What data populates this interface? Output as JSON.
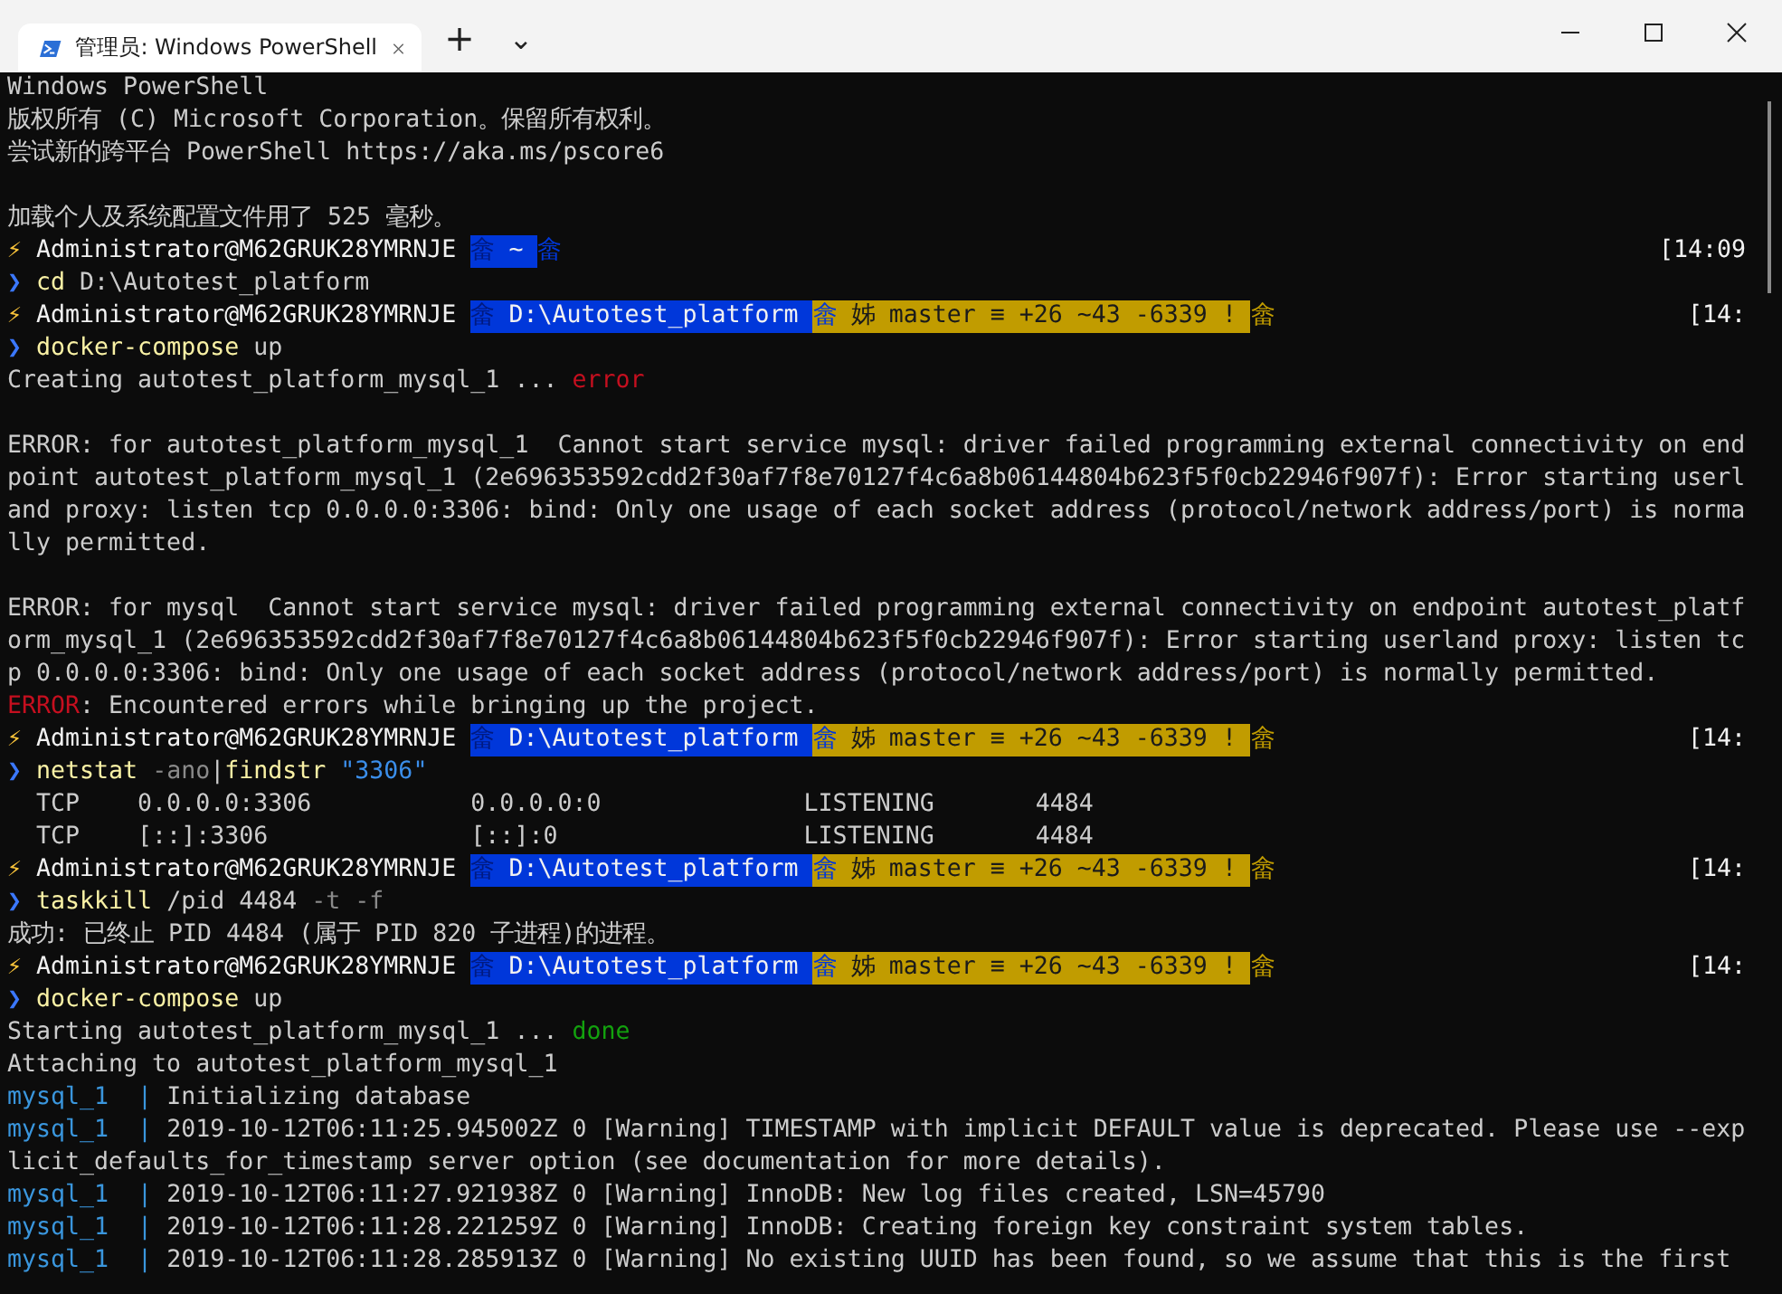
{
  "window": {
    "tab": {
      "title": "管理员: Windows PowerShell",
      "selected": true
    },
    "new_tab": "+",
    "dropdown": "⌄"
  },
  "terminal": {
    "lines": [
      {
        "kind": "output",
        "segments": [
          {
            "kind": "plain",
            "text": "Windows PowerShell"
          }
        ]
      },
      {
        "kind": "output",
        "segments": [
          {
            "kind": "plain",
            "text": "版权所有 (C) Microsoft Corporation。保留所有权利。"
          }
        ]
      },
      {
        "kind": "output",
        "segments": [
          {
            "kind": "plain",
            "text": "尝试新的跨平台 PowerShell https://aka.ms/pscore6"
          }
        ]
      },
      {
        "kind": "blank"
      },
      {
        "kind": "output",
        "segments": [
          {
            "kind": "plain",
            "text": "加载个人及系统配置文件用了 525 毫秒。"
          }
        ]
      },
      {
        "kind": "prompt",
        "time": "[14:09",
        "segments": [
          {
            "kind": "bolt",
            "text": "⚡"
          },
          {
            "kind": "user",
            "text": " Administrator@M62GRUK28YMRNJE "
          },
          {
            "kind": "pathsep",
            "text": "畲"
          },
          {
            "kind": "path",
            "text": " ~ "
          },
          {
            "kind": "endblue",
            "text": "畲"
          }
        ]
      },
      {
        "kind": "output",
        "segments": [
          {
            "kind": "caret",
            "text": "❯"
          },
          {
            "kind": "cmd",
            "text": " cd"
          },
          {
            "kind": "plain",
            "text": " D:\\Autotest_platform"
          }
        ]
      },
      {
        "kind": "prompt",
        "time": "[14:",
        "segments": [
          {
            "kind": "bolt",
            "text": "⚡"
          },
          {
            "kind": "user",
            "text": " Administrator@M62GRUK28YMRNJE "
          },
          {
            "kind": "pathsep",
            "text": "畲"
          },
          {
            "kind": "path",
            "text": " D:\\Autotest_platform "
          },
          {
            "kind": "gitsep",
            "text": "畲"
          },
          {
            "kind": "git",
            "text": " 姊 master ≡ +26 ~43 -6339 ! "
          },
          {
            "kind": "endgold",
            "text": "畲"
          }
        ]
      },
      {
        "kind": "output",
        "segments": [
          {
            "kind": "caret",
            "text": "❯"
          },
          {
            "kind": "cmd",
            "text": " docker-compose"
          },
          {
            "kind": "plain",
            "text": " up"
          }
        ]
      },
      {
        "kind": "output",
        "segments": [
          {
            "kind": "plain",
            "text": "Creating autotest_platform_mysql_1 ... "
          },
          {
            "kind": "err",
            "text": "error"
          }
        ]
      },
      {
        "kind": "blank"
      },
      {
        "kind": "output",
        "segments": [
          {
            "kind": "plain",
            "text": "ERROR: for autotest_platform_mysql_1  Cannot start service mysql: driver failed programming external connectivity on end"
          }
        ]
      },
      {
        "kind": "output",
        "segments": [
          {
            "kind": "plain",
            "text": "point autotest_platform_mysql_1 (2e696353592cdd2f30af7f8e70127f4c6a8b06144804b623f5f0cb22946f907f): Error starting userl"
          }
        ]
      },
      {
        "kind": "output",
        "segments": [
          {
            "kind": "plain",
            "text": "and proxy: listen tcp 0.0.0.0:3306: bind: Only one usage of each socket address (protocol/network address/port) is norma"
          }
        ]
      },
      {
        "kind": "output",
        "segments": [
          {
            "kind": "plain",
            "text": "lly permitted."
          }
        ]
      },
      {
        "kind": "blank"
      },
      {
        "kind": "output",
        "segments": [
          {
            "kind": "plain",
            "text": "ERROR: for mysql  Cannot start service mysql: driver failed programming external connectivity on endpoint autotest_platf"
          }
        ]
      },
      {
        "kind": "output",
        "segments": [
          {
            "kind": "plain",
            "text": "orm_mysql_1 (2e696353592cdd2f30af7f8e70127f4c6a8b06144804b623f5f0cb22946f907f): Error starting userland proxy: listen tc"
          }
        ]
      },
      {
        "kind": "output",
        "segments": [
          {
            "kind": "plain",
            "text": "p 0.0.0.0:3306: bind: Only one usage of each socket address (protocol/network address/port) is normally permitted."
          }
        ]
      },
      {
        "kind": "output",
        "segments": [
          {
            "kind": "err",
            "text": "ERROR"
          },
          {
            "kind": "plain",
            "text": ": Encountered errors while bringing up the project."
          }
        ]
      },
      {
        "kind": "prompt",
        "time": "[14:",
        "segments": [
          {
            "kind": "bolt",
            "text": "⚡"
          },
          {
            "kind": "user",
            "text": " Administrator@M62GRUK28YMRNJE "
          },
          {
            "kind": "pathsep",
            "text": "畲"
          },
          {
            "kind": "path",
            "text": " D:\\Autotest_platform "
          },
          {
            "kind": "gitsep",
            "text": "畲"
          },
          {
            "kind": "git",
            "text": " 姊 master ≡ +26 ~43 -6339 ! "
          },
          {
            "kind": "endgold",
            "text": "畲"
          }
        ]
      },
      {
        "kind": "output",
        "segments": [
          {
            "kind": "caret",
            "text": "❯"
          },
          {
            "kind": "cmd",
            "text": " netstat"
          },
          {
            "kind": "arg",
            "text": " -ano"
          },
          {
            "kind": "plain",
            "text": "|"
          },
          {
            "kind": "cmd",
            "text": "findstr"
          },
          {
            "kind": "str",
            "text": " \"3306\""
          }
        ]
      },
      {
        "kind": "output",
        "segments": [
          {
            "kind": "plain",
            "text": "  TCP    0.0.0.0:3306           0.0.0.0:0              LISTENING       4484"
          }
        ]
      },
      {
        "kind": "output",
        "segments": [
          {
            "kind": "plain",
            "text": "  TCP    [::]:3306              [::]:0                 LISTENING       4484"
          }
        ]
      },
      {
        "kind": "prompt",
        "time": "[14:",
        "segments": [
          {
            "kind": "bolt",
            "text": "⚡"
          },
          {
            "kind": "user",
            "text": " Administrator@M62GRUK28YMRNJE "
          },
          {
            "kind": "pathsep",
            "text": "畲"
          },
          {
            "kind": "path",
            "text": " D:\\Autotest_platform "
          },
          {
            "kind": "gitsep",
            "text": "畲"
          },
          {
            "kind": "git",
            "text": " 姊 master ≡ +26 ~43 -6339 ! "
          },
          {
            "kind": "endgold",
            "text": "畲"
          }
        ]
      },
      {
        "kind": "output",
        "segments": [
          {
            "kind": "caret",
            "text": "❯"
          },
          {
            "kind": "cmd",
            "text": " taskkill"
          },
          {
            "kind": "plain",
            "text": " /pid 4484"
          },
          {
            "kind": "arg",
            "text": " -t -f"
          }
        ]
      },
      {
        "kind": "output",
        "segments": [
          {
            "kind": "plain",
            "text": "成功: 已终止 PID 4484 (属于 PID 820 子进程)的进程。"
          }
        ]
      },
      {
        "kind": "prompt",
        "time": "[14:",
        "segments": [
          {
            "kind": "bolt",
            "text": "⚡"
          },
          {
            "kind": "user",
            "text": " Administrator@M62GRUK28YMRNJE "
          },
          {
            "kind": "pathsep",
            "text": "畲"
          },
          {
            "kind": "path",
            "text": " D:\\Autotest_platform "
          },
          {
            "kind": "gitsep",
            "text": "畲"
          },
          {
            "kind": "git",
            "text": " 姊 master ≡ +26 ~43 -6339 ! "
          },
          {
            "kind": "endgold",
            "text": "畲"
          }
        ]
      },
      {
        "kind": "output",
        "segments": [
          {
            "kind": "caret",
            "text": "❯"
          },
          {
            "kind": "cmd",
            "text": " docker-compose"
          },
          {
            "kind": "plain",
            "text": " up"
          }
        ]
      },
      {
        "kind": "output",
        "segments": [
          {
            "kind": "plain",
            "text": "Starting autotest_platform_mysql_1 ... "
          },
          {
            "kind": "ok",
            "text": "done"
          }
        ]
      },
      {
        "kind": "output",
        "segments": [
          {
            "kind": "plain",
            "text": "Attaching to autotest_platform_mysql_1"
          }
        ]
      },
      {
        "kind": "output",
        "segments": [
          {
            "kind": "svc",
            "text": "mysql_1  |"
          },
          {
            "kind": "plain",
            "text": " Initializing database"
          }
        ]
      },
      {
        "kind": "output",
        "segments": [
          {
            "kind": "svc",
            "text": "mysql_1  |"
          },
          {
            "kind": "plain",
            "text": " 2019-10-12T06:11:25.945002Z 0 [Warning] TIMESTAMP with implicit DEFAULT value is deprecated. Please use --exp"
          }
        ]
      },
      {
        "kind": "output",
        "segments": [
          {
            "kind": "plain",
            "text": "licit_defaults_for_timestamp server option (see documentation for more details)."
          }
        ]
      },
      {
        "kind": "output",
        "segments": [
          {
            "kind": "svc",
            "text": "mysql_1  |"
          },
          {
            "kind": "plain",
            "text": " 2019-10-12T06:11:27.921938Z 0 [Warning] InnoDB: New log files created, LSN=45790"
          }
        ]
      },
      {
        "kind": "output",
        "segments": [
          {
            "kind": "svc",
            "text": "mysql_1  |"
          },
          {
            "kind": "plain",
            "text": " 2019-10-12T06:11:28.221259Z 0 [Warning] InnoDB: Creating foreign key constraint system tables."
          }
        ]
      },
      {
        "kind": "output",
        "segments": [
          {
            "kind": "svc",
            "text": "mysql_1  |"
          },
          {
            "kind": "plain",
            "text": " 2019-10-12T06:11:28.285913Z 0 [Warning] No existing UUID has been found, so we assume that this is the first"
          }
        ]
      }
    ]
  }
}
